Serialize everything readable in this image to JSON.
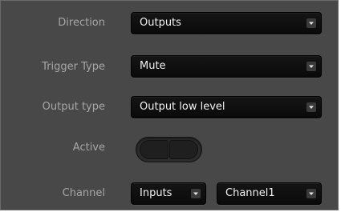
{
  "form": {
    "direction": {
      "label": "Direction",
      "value": "Outputs"
    },
    "trigger_type": {
      "label": "Trigger Type",
      "value": "Mute"
    },
    "output_type": {
      "label": "Output type",
      "value": "Output low level"
    },
    "active": {
      "label": "Active",
      "state": "off"
    },
    "channel": {
      "label": "Channel",
      "io_value": "Inputs",
      "channel_value": "Channel1"
    }
  },
  "icons": {
    "dropdown": "chevron-down-icon"
  },
  "colors": {
    "panel_bg": "#484848",
    "label_text": "#a6a6a6",
    "field_bg": "#121212",
    "field_text": "#f2f2f2"
  }
}
